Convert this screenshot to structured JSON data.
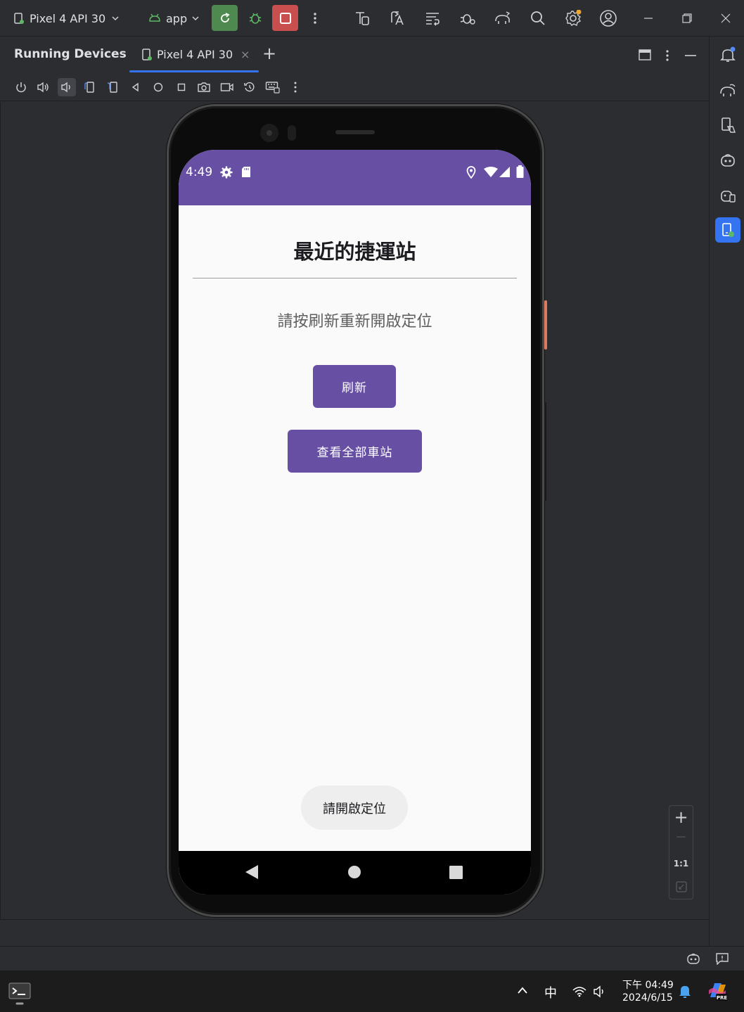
{
  "titlebar": {
    "device_selector": "Pixel 4 API 30",
    "run_config": "app"
  },
  "toolwindow": {
    "title": "Running Devices",
    "tab_label": "Pixel 4 API 30",
    "tab_close": "×",
    "add_tab": "+"
  },
  "phone": {
    "status_time": "4:49",
    "title": "最近的捷運站",
    "prompt": "請按刷新重新開啟定位",
    "refresh_button": "刷新",
    "view_all_button": "查看全部車站",
    "toast": "請開啟定位"
  },
  "zoom": {
    "zoom_in": "+",
    "zoom_out": "—",
    "actual_size": "1:1"
  },
  "taskbar": {
    "ime": "中",
    "time": "下午 04:49",
    "date": "2024/6/15"
  },
  "colors": {
    "accent": "#6750a4",
    "run_green": "#4e8a4f",
    "stop_red": "#c94f4f",
    "ide_bg": "#2b2d30",
    "tab_underline": "#3574f0"
  }
}
